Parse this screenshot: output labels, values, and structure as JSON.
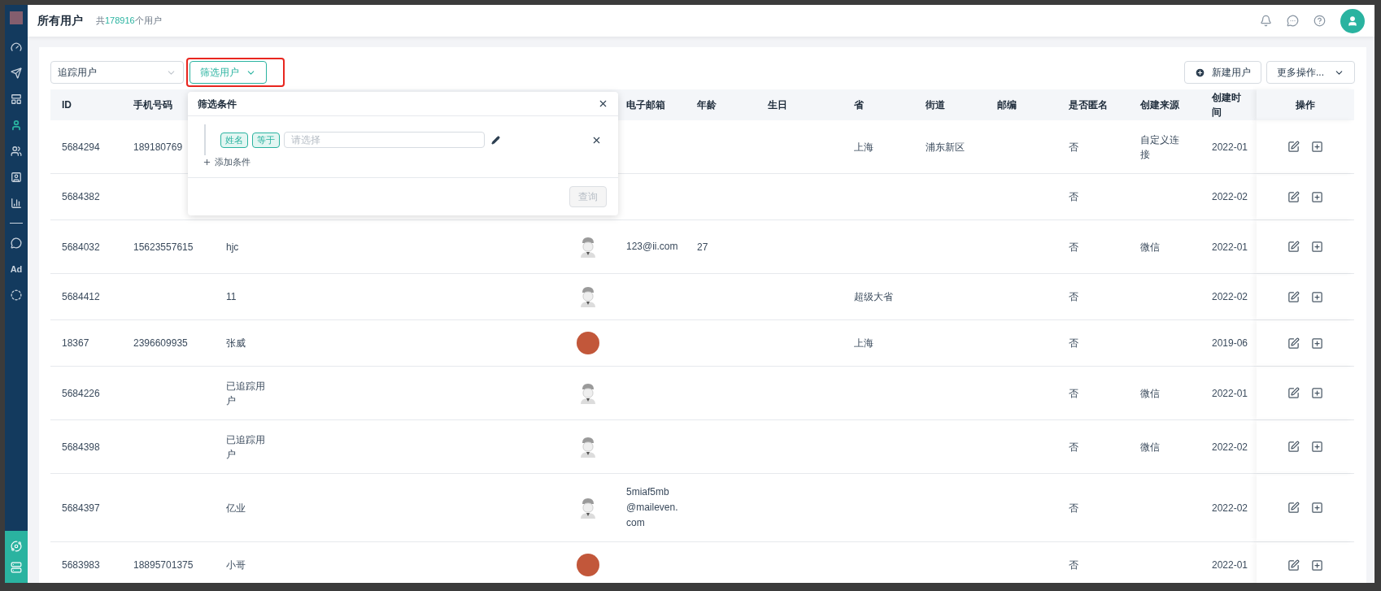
{
  "sidebar": {
    "items": [
      {
        "kind": "icon",
        "selected": false
      },
      {
        "kind": "icon",
        "selected": false
      },
      {
        "kind": "icon",
        "selected": false
      },
      {
        "kind": "icon",
        "selected": true
      },
      {
        "kind": "icon",
        "selected": false
      },
      {
        "kind": "icon",
        "selected": false
      },
      {
        "kind": "icon",
        "selected": false
      },
      {
        "kind": "divider"
      },
      {
        "kind": "icon",
        "selected": false
      },
      {
        "kind": "text",
        "label": "Ad",
        "selected": false
      },
      {
        "kind": "icon",
        "selected": false
      }
    ]
  },
  "header": {
    "title": "所有用户",
    "count_prefix": "共",
    "count": "178916",
    "count_suffix": "个用户"
  },
  "toolbar": {
    "track_select": "追踪用户",
    "filter_button": "筛选用户",
    "new_button": "新建用户",
    "more_button": "更多操作..."
  },
  "columns": {
    "id": "ID",
    "phone": "手机号码",
    "email": "电子邮箱",
    "age": "年龄",
    "birthday": "生日",
    "province": "省",
    "street": "街道",
    "zip": "邮编",
    "anonymous": "是否匿名",
    "source": "创建来源",
    "created": "创建时间",
    "actions": "操作"
  },
  "rows": [
    {
      "id": "5684294",
      "phone": "189180769",
      "province": "上海",
      "street": "浦东新区",
      "anonymous": "否",
      "source": "自定义连接",
      "created": "2022-01"
    },
    {
      "id": "5684382",
      "anonymous": "否",
      "created": "2022-02"
    },
    {
      "id": "5684032",
      "phone": "15623557615",
      "name": "hjc",
      "avatar": {
        "kind": "default"
      },
      "email": "123@ii.com",
      "age": "27",
      "anonymous": "否",
      "source": "微信",
      "created": "2022-01"
    },
    {
      "id": "5684412",
      "name": "11",
      "avatar": {
        "kind": "default"
      },
      "province": "超级大省",
      "anonymous": "否",
      "created": "2022-02"
    },
    {
      "id": "18367",
      "phone": "2396609935",
      "name": "张威",
      "avatar": {
        "kind": "photo"
      },
      "province": "上海",
      "anonymous": "否",
      "created": "2019-06"
    },
    {
      "id": "5684226",
      "name": "已追踪用户",
      "avatar": {
        "kind": "default"
      },
      "anonymous": "否",
      "source": "微信",
      "created": "2022-01"
    },
    {
      "id": "5684398",
      "name": "已追踪用户",
      "avatar": {
        "kind": "default"
      },
      "anonymous": "否",
      "source": "微信",
      "created": "2022-02"
    },
    {
      "id": "5684397",
      "name": "亿业",
      "avatar": {
        "kind": "default"
      },
      "email": "5miaf5mb@maileven.com",
      "anonymous": "否",
      "created": "2022-02"
    },
    {
      "id": "5683983",
      "phone": "18895701375",
      "name": "小哥",
      "avatar": {
        "kind": "photo"
      },
      "anonymous": "否",
      "created": "2022-01"
    }
  ],
  "filter_popup": {
    "title": "筛选条件",
    "condition": {
      "field": "姓名",
      "operator": "等于",
      "placeholder": "请选择"
    },
    "add_condition": "添加条件",
    "query_button": "查询",
    "query_disabled": true
  }
}
